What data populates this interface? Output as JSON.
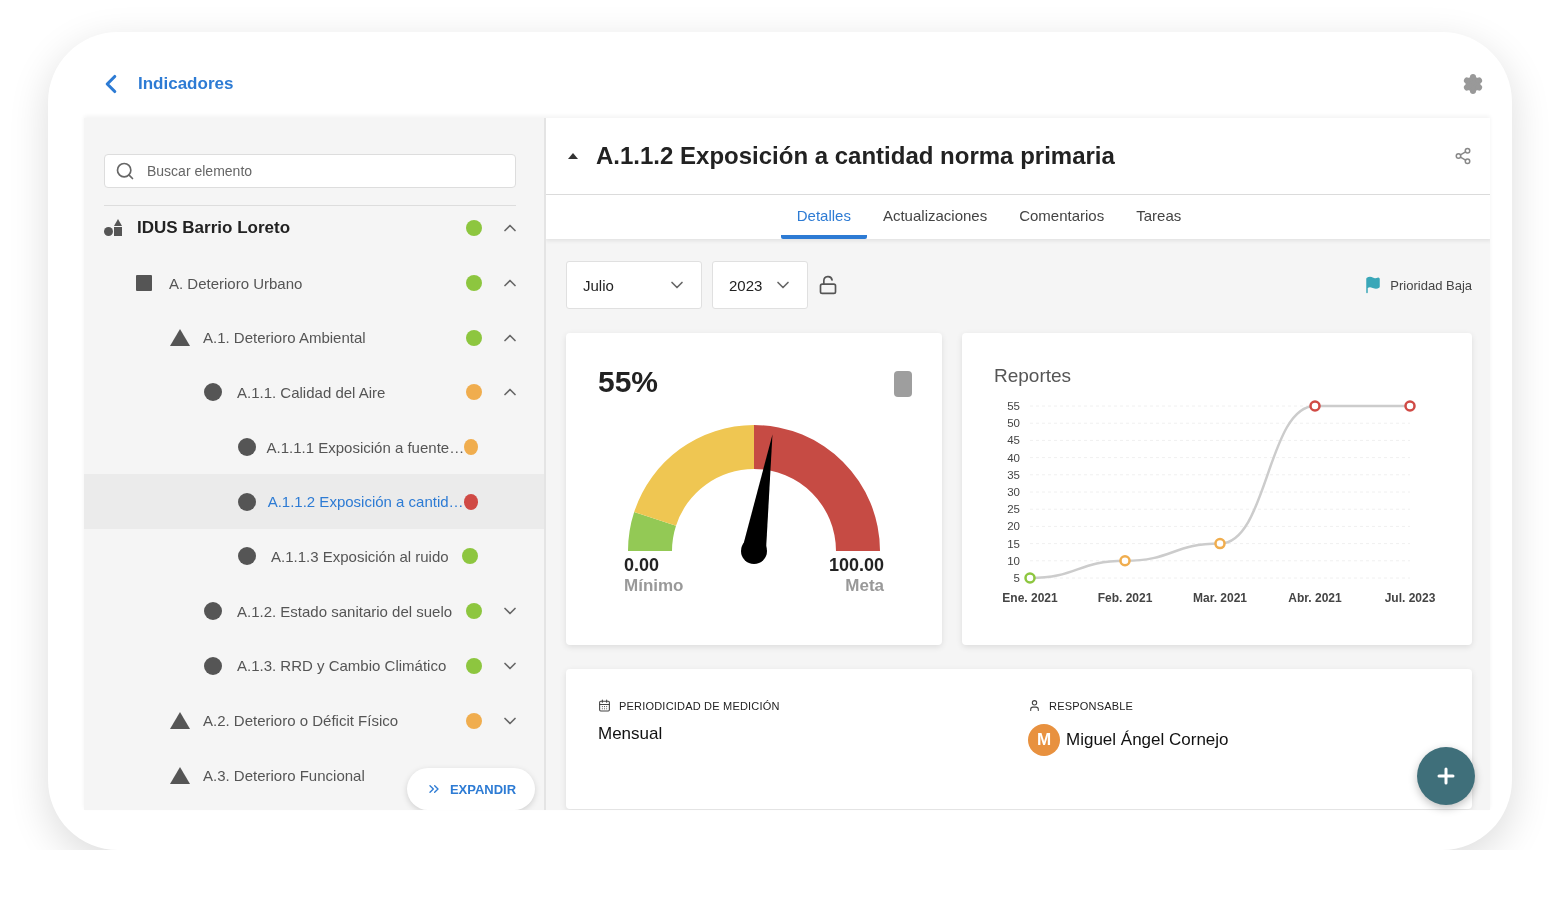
{
  "header": {
    "back_label": "Indicadores"
  },
  "sidebar": {
    "search": {
      "placeholder": "Buscar elemento"
    },
    "tree": [
      {
        "kind": "root",
        "label": "IDUS Barrio Loreto",
        "color": "#8dc63f",
        "expanded": true,
        "selected": false,
        "children": [
          {
            "kind": "square",
            "label": "A. Deterioro Urbano",
            "color": "#8dc63f",
            "expanded": true,
            "selected": false,
            "children": [
              {
                "kind": "triangle",
                "label": "A.1. Deterioro Ambiental",
                "color": "#8dc63f",
                "expanded": true,
                "selected": false,
                "children": [
                  {
                    "kind": "circle",
                    "label": "A.1.1. Calidad del Aire",
                    "color": "#f0ad4e",
                    "expanded": true,
                    "selected": false,
                    "children": [
                      {
                        "kind": "circle",
                        "label": "A.1.1.1 Exposición a fuente…",
                        "color": "#f0ad4e",
                        "selected": false
                      },
                      {
                        "kind": "circle",
                        "label": "A.1.1.2 Exposición a cantid…",
                        "color": "#d04a45",
                        "selected": true
                      },
                      {
                        "kind": "circle",
                        "label": "A.1.1.3 Exposición al ruido",
                        "color": "#8dc63f",
                        "selected": false
                      }
                    ]
                  },
                  {
                    "kind": "circle",
                    "label": "A.1.2. Estado sanitario del suelo",
                    "color": "#8dc63f",
                    "expanded": false,
                    "selected": false
                  },
                  {
                    "kind": "circle",
                    "label": "A.1.3. RRD y Cambio Climático",
                    "color": "#8dc63f",
                    "expanded": false,
                    "selected": false
                  }
                ]
              },
              {
                "kind": "triangle",
                "label": "A.2. Deterioro o Déficit Físico",
                "color": "#f0ad4e",
                "expanded": false,
                "selected": false
              },
              {
                "kind": "triangle",
                "label": "A.3. Deterioro Funcional",
                "selected": false
              }
            ]
          }
        ]
      }
    ],
    "expand_button": "EXPANDIR"
  },
  "detail": {
    "title": "A.1.1.2 Exposición a cantidad norma primaria",
    "tabs": [
      {
        "label": "Detalles",
        "selected": true
      },
      {
        "label": "Actualizaciones",
        "selected": false
      },
      {
        "label": "Comentarios",
        "selected": false
      },
      {
        "label": "Tareas",
        "selected": false
      }
    ],
    "month": "Julio",
    "year": "2023",
    "locked": false,
    "priority": "Prioridad Baja",
    "gauge": {
      "value": "55%",
      "level": 0.55,
      "min_value": "0.00",
      "min_label": "Mínimo",
      "max_value": "100.00",
      "max_label": "Meta"
    },
    "reports": {
      "chart_data": {
        "type": "line",
        "title": "Reportes",
        "categories": [
          "Ene. 2021",
          "Feb. 2021",
          "Mar. 2021",
          "Abr. 2021",
          "Jul. 2023"
        ],
        "series": [
          {
            "color": "#cccccc",
            "values": [
              5,
              10,
              15,
              55,
              55
            ],
            "marker": "circle"
          }
        ],
        "grid": true,
        "ylim": [
          5,
          55
        ],
        "yticks": [
          5,
          10,
          15,
          20,
          25,
          30,
          35,
          40,
          45,
          50,
          55
        ]
      }
    },
    "info": [
      {
        "kind": "text",
        "label": "PERIODICIDAD DE MEDICIÓN",
        "value": "Mensual"
      },
      {
        "kind": "person",
        "label": "RESPONSABLE",
        "initial": "M",
        "value": "Miguel Ángel Cornejo"
      }
    ]
  }
}
